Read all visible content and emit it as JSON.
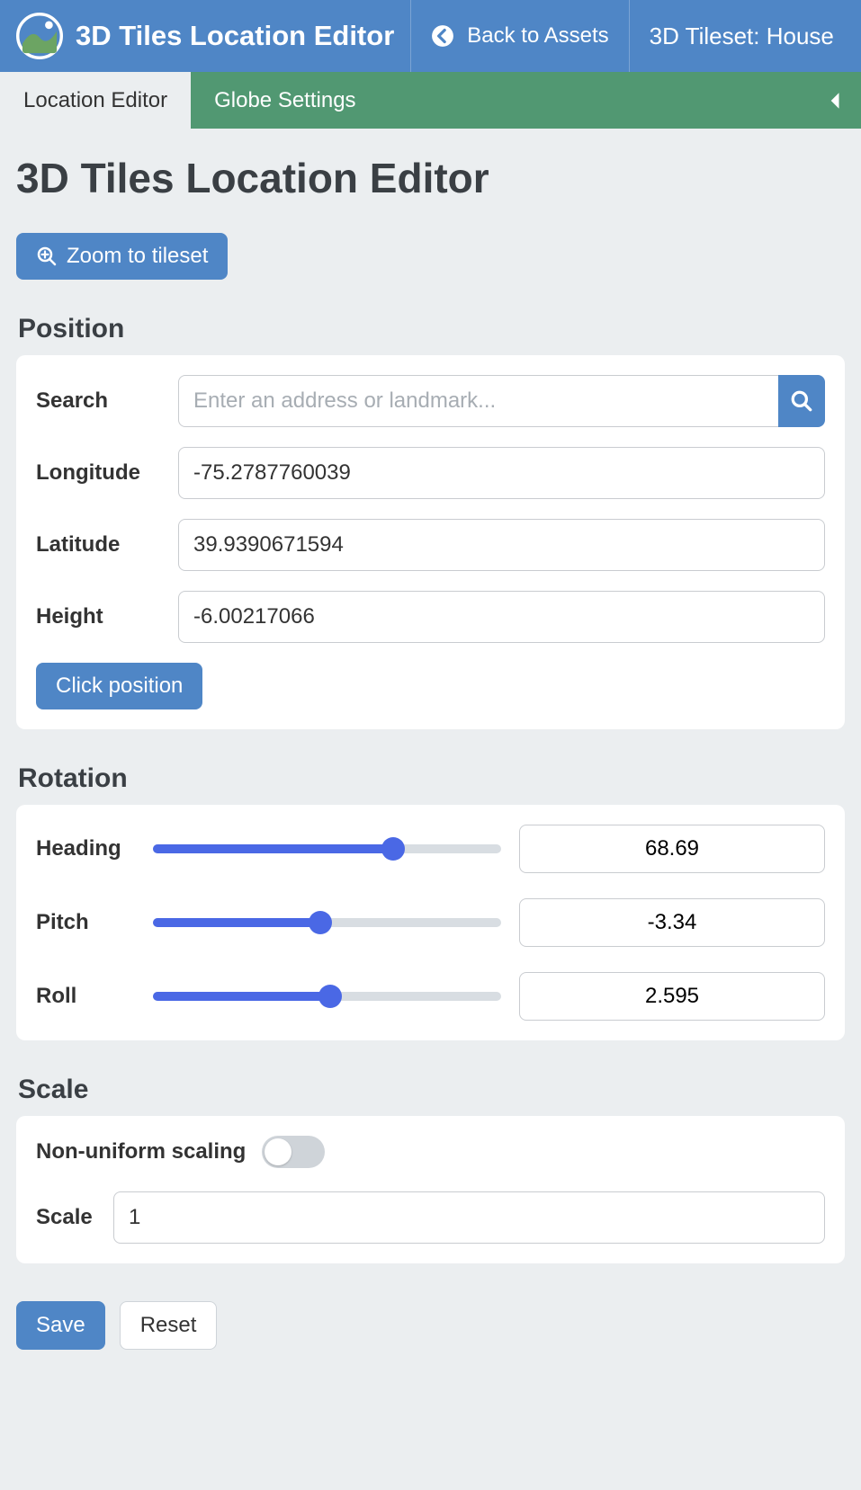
{
  "header": {
    "app_title": "3D Tiles Location Editor",
    "back_label": "Back to Assets",
    "tileset_label": "3D Tileset: House"
  },
  "tabs": {
    "location_editor": "Location Editor",
    "globe_settings": "Globe Settings"
  },
  "page": {
    "title": "3D Tiles Location Editor",
    "zoom_button": "Zoom to tileset"
  },
  "position": {
    "section_title": "Position",
    "search_label": "Search",
    "search_placeholder": "Enter an address or landmark...",
    "longitude_label": "Longitude",
    "longitude_value": "-75.2787760039",
    "latitude_label": "Latitude",
    "latitude_value": "39.9390671594",
    "height_label": "Height",
    "height_value": "-6.00217066",
    "click_position_button": "Click position"
  },
  "rotation": {
    "section_title": "Rotation",
    "heading_label": "Heading",
    "heading_value": "68.69",
    "heading_fill_pct": "69%",
    "pitch_label": "Pitch",
    "pitch_value": "-3.34",
    "pitch_fill_pct": "48%",
    "roll_label": "Roll",
    "roll_value": "2.595",
    "roll_fill_pct": "51%"
  },
  "scale": {
    "section_title": "Scale",
    "toggle_label": "Non-uniform scaling",
    "scale_label": "Scale",
    "scale_value": "1"
  },
  "footer": {
    "save": "Save",
    "reset": "Reset"
  }
}
